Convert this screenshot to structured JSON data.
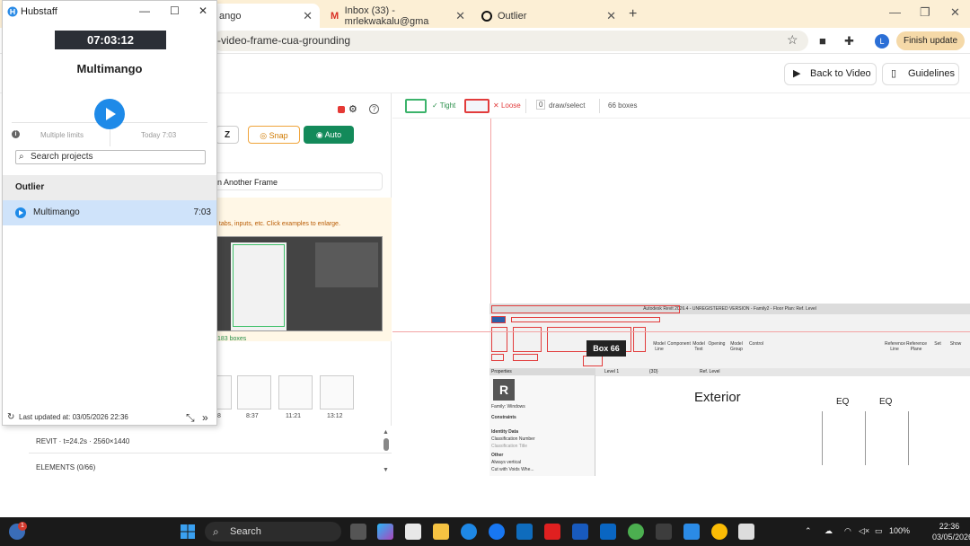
{
  "browser": {
    "tabs": [
      {
        "label": "ango",
        "active": true
      },
      {
        "label": "Inbox (33) - mrlekwakalu@gma",
        "active": false
      },
      {
        "label": "Outlier",
        "active": false
      }
    ],
    "url": "-video-frame-cua-grounding",
    "profile_initial": "L",
    "finish_update": "Finish update"
  },
  "header": {
    "back_to_video": "Back to Video",
    "guidelines": "Guidelines"
  },
  "left_panel": {
    "z_label": "Z",
    "snap": "Snap",
    "auto": "Auto",
    "another_frame": "n Another Frame",
    "warn_text": ", tabs, inputs, etc. Click examples to enlarge.",
    "boxes_count": "183 boxes",
    "thumbs": [
      "8",
      "8:37",
      "11:21",
      "13:12"
    ],
    "revit_row": "REVIT · t=24.2s · 2560×1440",
    "elements_row": "ELEMENTS (0/66)"
  },
  "canvas": {
    "tight": "Tight",
    "loose": "Loose",
    "draw_key": "0",
    "draw_select": "draw/select",
    "boxes": "66 boxes",
    "box_tag": "Box 66",
    "revit_title": "Autodesk Revit 2026.4 - UNREGISTERED VERSION - Family2 - Floor Plan: Ref. Level",
    "ribbon": [
      "Model Line",
      "Component",
      "Model Text",
      "Opening",
      "Model Group",
      "Control",
      "Reference Line",
      "Reference Plane",
      "Set",
      "Show"
    ],
    "properties_label": "Properties",
    "family_label": "Family: Windows",
    "constraints": "Constraints",
    "identity": "Identity Data",
    "class_number": "Classification Number",
    "class_title": "Classification Title",
    "other": "Other",
    "always_vertical": "Always vertical",
    "cut_with_voids": "Cut with Voids Whe...",
    "view_tabs": [
      "Level 1",
      "{3D}",
      "Ref. Level"
    ],
    "exterior": "Exterior",
    "eq1": "EQ",
    "eq2": "EQ"
  },
  "hubstaff": {
    "title": "Hubstaff",
    "timer": "07:03:12",
    "project_name": "Multimango",
    "limits": "Multiple limits",
    "today": "Today 7:03",
    "search_placeholder": "Search projects",
    "org": "Outlier",
    "project_row": "Multimango",
    "project_time": "7:03",
    "last_updated": "Last updated at: 03/05/2026 22:36"
  },
  "taskbar": {
    "search": "Search",
    "battery": "100%",
    "time": "22:36",
    "date": "03/05/2026"
  }
}
